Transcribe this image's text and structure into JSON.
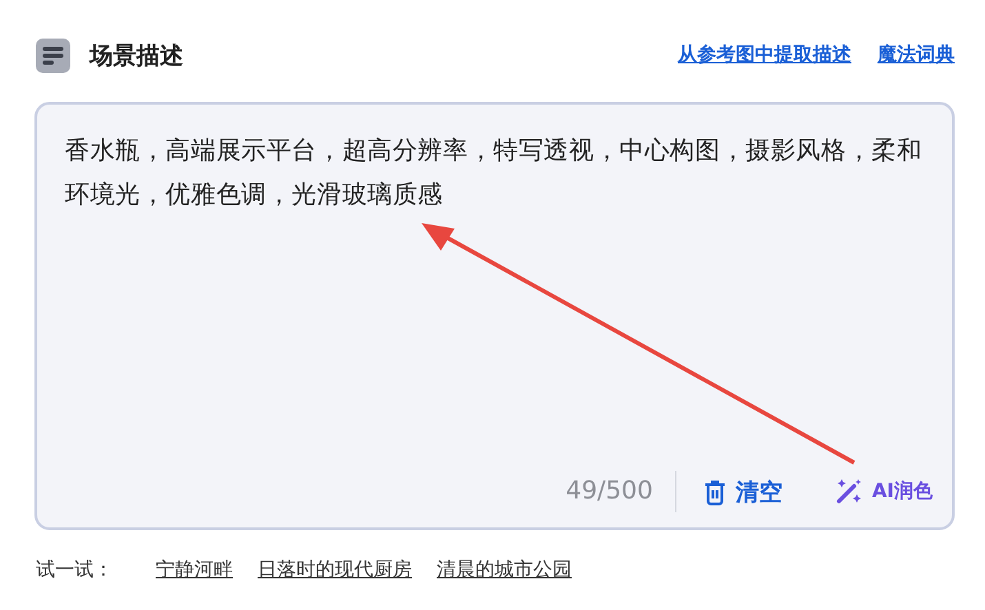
{
  "header": {
    "title": "场景描述",
    "links": [
      "从参考图中提取描述",
      "魔法词典"
    ]
  },
  "editor": {
    "value": "香水瓶，高端展示平台，超高分辨率，特写透视，中心构图，摄影风格，柔和环境光，优雅色调，光滑玻璃质感",
    "counter": "49/500",
    "clear_label": "清空",
    "polish_label": "AI润色"
  },
  "annotation": {
    "kind": "arrow",
    "color": "#e8473f"
  },
  "suggestions": {
    "label": "试一试：",
    "items": [
      "宁静河畔",
      "日落时的现代厨房",
      "清晨的城市公园"
    ]
  }
}
